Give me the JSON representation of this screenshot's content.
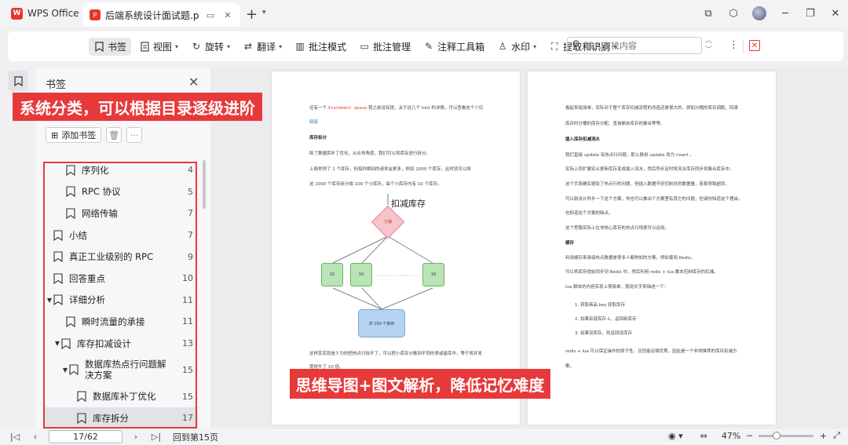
{
  "app": {
    "name": "WPS Office"
  },
  "tab": {
    "title": "后端系统设计面试题.pdf"
  },
  "toolbar": {
    "items": [
      {
        "label": "书签",
        "icon": "bookmark-icon"
      },
      {
        "label": "视图",
        "icon": "view-icon"
      },
      {
        "label": "旋转",
        "icon": "rotate-icon"
      },
      {
        "label": "翻译",
        "icon": "translate-icon"
      },
      {
        "label": "批注模式",
        "icon": "annotate-mode-icon"
      },
      {
        "label": "批注管理",
        "icon": "annotate-manage-icon"
      },
      {
        "label": "注释工具箱",
        "icon": "toolbox-icon"
      },
      {
        "label": "水印",
        "icon": "watermark-icon"
      },
      {
        "label": "提取和识别",
        "icon": "extract-icon"
      }
    ],
    "search_placeholder": "输入查找内容"
  },
  "panel": {
    "title": "书签",
    "add_label": "添加书签"
  },
  "bookmarks": [
    {
      "label": "序列化",
      "page": "4"
    },
    {
      "label": "RPC 协议",
      "page": "5"
    },
    {
      "label": "网络传输",
      "page": "7"
    },
    {
      "label": "小结",
      "page": "7"
    },
    {
      "label": "真正工业级别的 RPC",
      "page": "9"
    },
    {
      "label": "回答重点",
      "page": "10"
    },
    {
      "label": "详细分析",
      "page": "11"
    },
    {
      "label": "瞬时流量的承接",
      "page": "11"
    },
    {
      "label": "库存扣减设计",
      "page": "13"
    },
    {
      "label": "数据库热点行问题解决方案",
      "page": "15"
    },
    {
      "label": "数据库补丁优化",
      "page": "15"
    },
    {
      "label": "库存拆分",
      "page": "17"
    }
  ],
  "overlays": {
    "banner_top": "系统分类，可以根据目录逐级进阶",
    "banner_bottom": "思维导图+图文解析，降低记忆难度"
  },
  "page_left": {
    "l1_pre": "还有一个 ",
    "l1_code": "Statement queue",
    "l1_post": " 我之前没有提，关于这几个 hint 的详情，可以查看这个",
    "l1_link": "介绍",
    "l2_link": "链接",
    "h1": "库存拆分",
    "l3": "除了数据库补丁优化，从业务角度，我们可以将库存进行拆分。",
    "l4": "上面举例了 1 个库存，但每秒瞬间的请求会更多，例如 1000 个库存，此时就可以将",
    "l5": "这 1000 个库存拆分成 100 个小库存，每个小库存内有 10 个库存。",
    "diagram_title": "扣减库存",
    "diamond": "分桶",
    "box": "10",
    "bottom_box": "共 100 个库存",
    "l6": "这样其实就是人为的把热点行拆开了，可以把小库存分散到不同的表或者库中，等于将并发",
    "l7": "度提升了 10 倍。"
  },
  "page_right": {
    "l1": "看起来挺简单，实际对于整个库存扣减流程的改造还是很大的，例如分桶的库存调配、回滚",
    "l2": "库存时分桶的库存分配、查询剩余库存的聚合等等。",
    "h1": "插入库存扣减流水",
    "l3": "我们直接 update 有热点行问题，那么换用 update 改为 insert 。",
    "l4": "实际上同扩展实从更新库存变成插入流水，然后异步定时将流水库存同步到聚合库存中。",
    "l5": "这个手段确实避免了热点行的问题，但插入数据不好控制总的数据量，容易导致超卖。",
    "l6": "可以新设计异步一下这个方案，你也可以推出个方案里有其它的问题，但请你知道这个理由，",
    "l7": "也知道这个方案的缺点。",
    "l8": "这个思路实际上在非核心库存的热点行场景可以运用。",
    "h2": "缓存",
    "l9": "利用缓存来承接热点数据是很多人都熟知的方案，例如使用 Redis。",
    "l10": "可以将库存提前同步到 Redis 中，然后利用 redis + lua 脚本控制库存的扣减。",
    "l11": "lua 脚本的内容实现上很简单，我用文字来描述一下：",
    "li1": "1.  获取商品 key 获取库存",
    "li2": "2.  如果有就库存-1，返回新库存",
    "li3": "3.  如果没库存，则返回没库存",
    "l12": "redis + lua 可以保证操作的原子性，且性能足够优秀，因此是一个非常推荐的库存扣减方",
    "l13": "案。"
  },
  "status": {
    "page_value": "17/62",
    "back_text": "回到第15页",
    "zoom": "47%"
  },
  "colors": {
    "accent_red": "#e8393a",
    "link_blue": "#3c78c8"
  }
}
